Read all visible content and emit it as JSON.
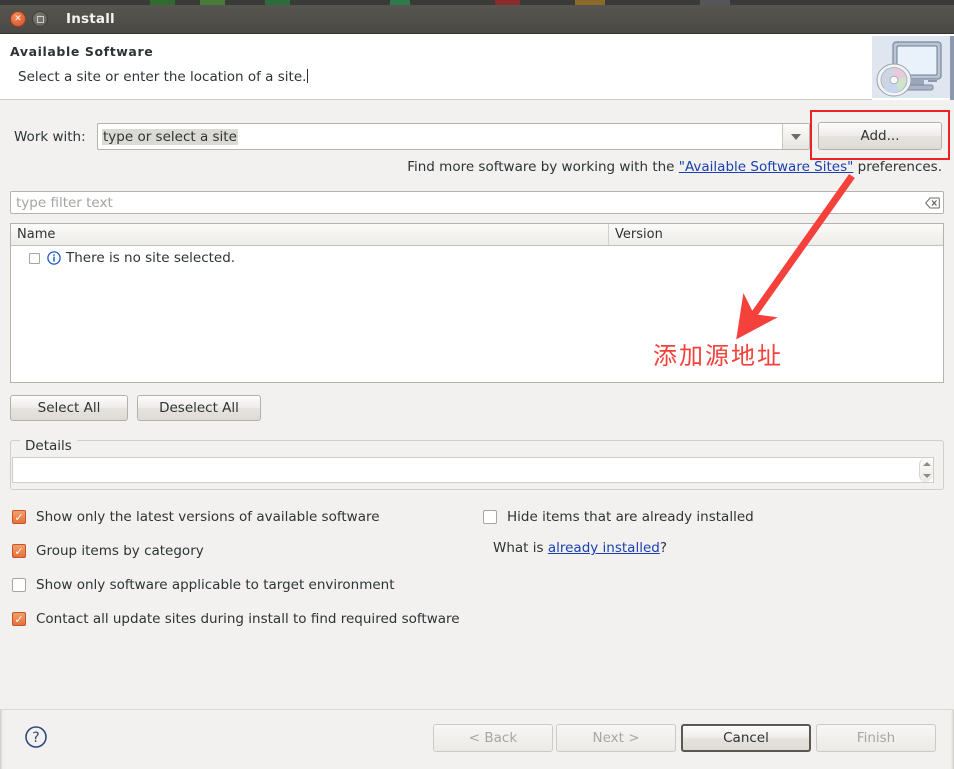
{
  "window": {
    "title": "Install",
    "close_icon": "close-icon",
    "maximize_icon": "maximize-icon"
  },
  "header": {
    "title": "Available Software",
    "message": "Select a site or enter the location of a site.",
    "banner_icon": "install-monitor-disc-icon"
  },
  "work_with": {
    "label": "Work with:",
    "value": "type or select a site",
    "dropdown_icon": "chevron-down-icon",
    "add_button": "Add..."
  },
  "find_more": {
    "prefix": "Find more software by working with the ",
    "link": "\"Available Software Sites\"",
    "suffix": " preferences."
  },
  "filter": {
    "placeholder": "type filter text",
    "clear_icon": "clear-text-icon"
  },
  "table": {
    "columns": [
      "Name",
      "Version"
    ],
    "rows": [
      {
        "checked": false,
        "icon": "info-icon",
        "name": "There is no site selected.",
        "version": ""
      }
    ]
  },
  "list_buttons": {
    "select_all": "Select All",
    "deselect_all": "Deselect All"
  },
  "details": {
    "legend": "Details",
    "content": "",
    "spinner_icon": "spinner-updown-icon"
  },
  "options": {
    "left": [
      {
        "label": "Show only the latest versions of available software",
        "checked": true
      },
      {
        "label": "Group items by category",
        "checked": true
      },
      {
        "label": "Show only software applicable to target environment",
        "checked": false
      },
      {
        "label": "Contact all update sites during install to find required software",
        "checked": true
      }
    ],
    "right": [
      {
        "label": "Hide items that are already installed",
        "checked": false
      }
    ],
    "what_is": {
      "prefix": "What is ",
      "link": "already installed",
      "suffix": "?"
    }
  },
  "footer": {
    "help_icon": "help-question-icon",
    "buttons": [
      {
        "label": "< Back",
        "enabled": false,
        "focused": false
      },
      {
        "label": "Next >",
        "enabled": false,
        "focused": false
      },
      {
        "label": "Cancel",
        "enabled": true,
        "focused": true
      },
      {
        "label": "Finish",
        "enabled": false,
        "focused": false
      }
    ]
  },
  "annotations": {
    "highlight_color": "#ee2222",
    "arrow_color": "#f4413c",
    "text_color": "#f4413c",
    "note_text": "添加源地址"
  }
}
